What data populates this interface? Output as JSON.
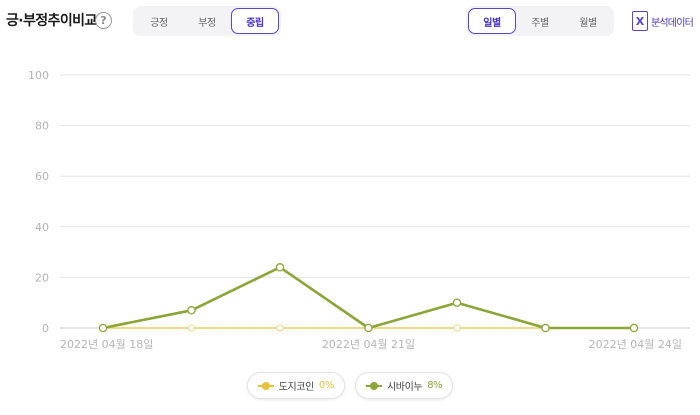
{
  "header": {
    "title": "긍·부정추이비교",
    "help_icon": "question-circle-icon"
  },
  "sentiment_tabs": {
    "items": [
      "긍정",
      "부정",
      "중립"
    ],
    "active": "중립"
  },
  "period_tabs": {
    "items": [
      "일별",
      "주별",
      "월별"
    ],
    "active": "일별"
  },
  "export": {
    "label": "분석데이터",
    "icon": "excel-icon",
    "icon_glyph": "X"
  },
  "colors": {
    "accent": "#5b43d6",
    "series_1": "#e7c33c",
    "series_2": "#8aa636"
  },
  "legend": [
    {
      "name": "도지코인",
      "pct": "0%",
      "color": "#e7c33c"
    },
    {
      "name": "시바이누",
      "pct": "8%",
      "color": "#8aa636"
    }
  ],
  "chart_data": {
    "type": "line",
    "x": [
      "2022-04-18",
      "2022-04-19",
      "2022-04-20",
      "2022-04-21",
      "2022-04-22",
      "2022-04-23",
      "2022-04-24"
    ],
    "x_tick_labels": [
      "2022년 04월 18일",
      "2022년 04월 21일",
      "2022년 04월 24일"
    ],
    "x_tick_index": [
      0,
      3,
      6
    ],
    "ylim": [
      0,
      100
    ],
    "yticks": [
      0,
      20,
      40,
      60,
      80,
      100
    ],
    "grid": true,
    "legend_position": "bottom",
    "series": [
      {
        "name": "도지코인",
        "values": [
          0,
          0,
          0,
          0,
          0,
          0,
          0
        ]
      },
      {
        "name": "시바이누",
        "values": [
          0,
          7,
          24,
          0,
          10,
          0,
          0
        ]
      }
    ]
  }
}
